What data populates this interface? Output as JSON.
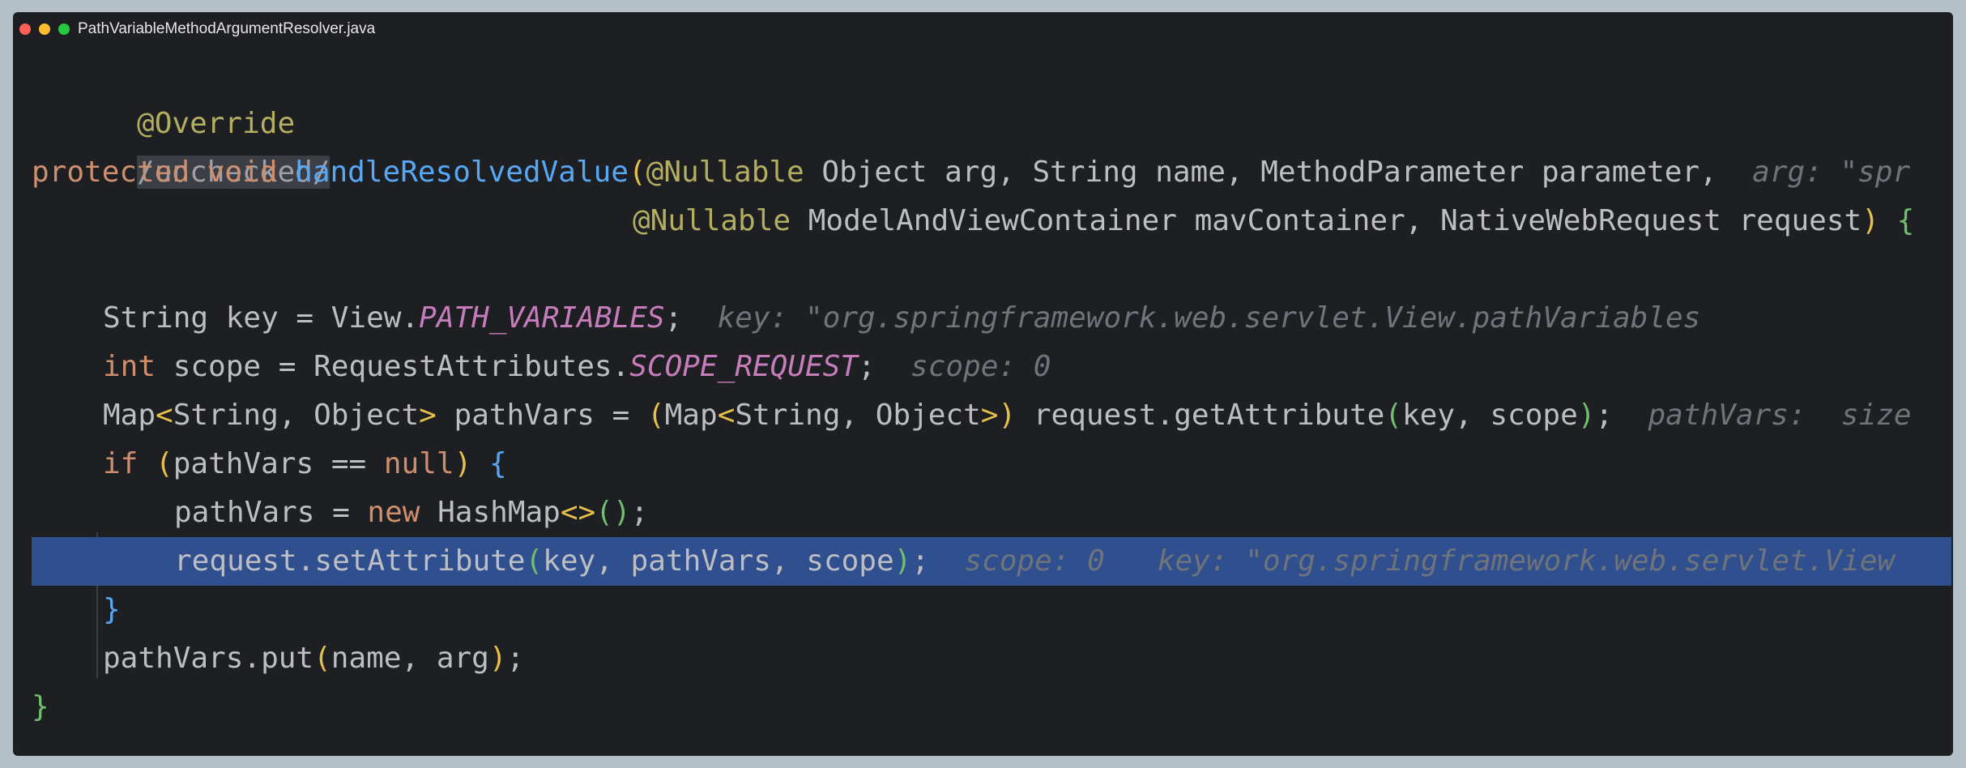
{
  "window": {
    "title": "PathVariableMethodArgumentResolver.java",
    "colors": {
      "background": "#1e1f22",
      "highlight": "#2f4f8f"
    }
  },
  "code": {
    "l1": {
      "annotation": "@Override"
    },
    "l2": {
      "text": "/unchecked/"
    },
    "l3": {
      "kw_protected": "protected",
      "kw_void": "void",
      "method": "handleResolvedValue",
      "open": "(",
      "anno": "@Nullable",
      "params": " Object arg, String name, MethodParameter parameter,",
      "hint": "arg: \"spr"
    },
    "l4": {
      "anno": "@Nullable",
      "params": " ModelAndViewContainer mavContainer, NativeWebRequest request",
      "close": ")",
      "brace": "{"
    },
    "l5": {
      "pre": "String key = View.",
      "const": "PATH_VARIABLES",
      "post": ";",
      "hint": "key: \"org.springframework.web.servlet.View.pathVariables"
    },
    "l6": {
      "kw": "int",
      "pre": " scope = RequestAttributes.",
      "const": "SCOPE_REQUEST",
      "post": ";",
      "hint": "scope: 0"
    },
    "l7": {
      "a": "Map",
      "lt1": "<",
      "b": "String, Object",
      "gt1": ">",
      "c": " pathVars = ",
      "p1": "(",
      "d": "Map",
      "lt2": "<",
      "e": "String, Object",
      "gt2": ">",
      "p2": ")",
      "f": " request.getAttribute",
      "p3": "(",
      "g": "key, scope",
      "p4": ")",
      "h": ";",
      "hint": "pathVars:  size"
    },
    "l8": {
      "kw": "if",
      "p1": "(",
      "a": "pathVars ",
      "op": "==",
      "b": " ",
      "kw2": "null",
      "p2": ")",
      "brace": "{"
    },
    "l9": {
      "a": "pathVars = ",
      "kw": "new",
      "b": " HashMap",
      "diamond": "<>",
      "p": "()",
      "c": ";"
    },
    "l10": {
      "a": "request.setAttribute",
      "p1": "(",
      "b": "key, pathVars, scope",
      "p2": ")",
      "c": ";",
      "hint1": "scope: 0",
      "hint2": "key: \"org.springframework.web.servlet.View"
    },
    "l11": {
      "brace": "}"
    },
    "l12": {
      "a": "pathVars.put",
      "p1": "(",
      "b": "name, arg",
      "p2": ")",
      "c": ";"
    },
    "l13": {
      "brace": "}"
    }
  }
}
